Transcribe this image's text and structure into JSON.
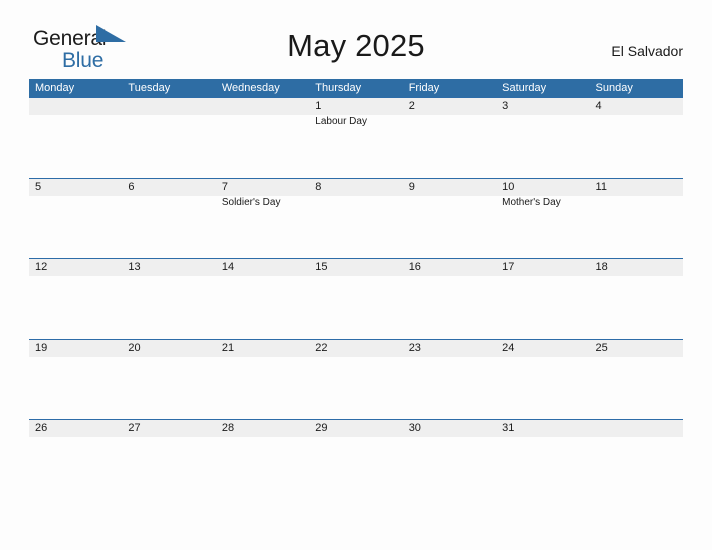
{
  "brand": {
    "name_top": "General",
    "name_bottom": "Blue",
    "flag_icon": "triangle-flag-icon",
    "accent_color": "#2e6da4",
    "text_color": "#1c1c1c"
  },
  "header": {
    "title": "May 2025",
    "country": "El Salvador"
  },
  "theme": {
    "header_bar_color": "#2e6da4",
    "row_rule_color": "#2d6ca8",
    "band_color": "#efefef",
    "page_background": "#fdfdfd"
  },
  "calendar": {
    "weekdays": [
      "Monday",
      "Tuesday",
      "Wednesday",
      "Thursday",
      "Friday",
      "Saturday",
      "Sunday"
    ],
    "weeks": [
      [
        {
          "date": "",
          "event": ""
        },
        {
          "date": "",
          "event": ""
        },
        {
          "date": "",
          "event": ""
        },
        {
          "date": "1",
          "event": "Labour Day"
        },
        {
          "date": "2",
          "event": ""
        },
        {
          "date": "3",
          "event": ""
        },
        {
          "date": "4",
          "event": ""
        }
      ],
      [
        {
          "date": "5",
          "event": ""
        },
        {
          "date": "6",
          "event": ""
        },
        {
          "date": "7",
          "event": "Soldier's Day"
        },
        {
          "date": "8",
          "event": ""
        },
        {
          "date": "9",
          "event": ""
        },
        {
          "date": "10",
          "event": "Mother's Day"
        },
        {
          "date": "11",
          "event": ""
        }
      ],
      [
        {
          "date": "12",
          "event": ""
        },
        {
          "date": "13",
          "event": ""
        },
        {
          "date": "14",
          "event": ""
        },
        {
          "date": "15",
          "event": ""
        },
        {
          "date": "16",
          "event": ""
        },
        {
          "date": "17",
          "event": ""
        },
        {
          "date": "18",
          "event": ""
        }
      ],
      [
        {
          "date": "19",
          "event": ""
        },
        {
          "date": "20",
          "event": ""
        },
        {
          "date": "21",
          "event": ""
        },
        {
          "date": "22",
          "event": ""
        },
        {
          "date": "23",
          "event": ""
        },
        {
          "date": "24",
          "event": ""
        },
        {
          "date": "25",
          "event": ""
        }
      ],
      [
        {
          "date": "26",
          "event": ""
        },
        {
          "date": "27",
          "event": ""
        },
        {
          "date": "28",
          "event": ""
        },
        {
          "date": "29",
          "event": ""
        },
        {
          "date": "30",
          "event": ""
        },
        {
          "date": "31",
          "event": ""
        },
        {
          "date": "",
          "event": ""
        }
      ]
    ]
  }
}
